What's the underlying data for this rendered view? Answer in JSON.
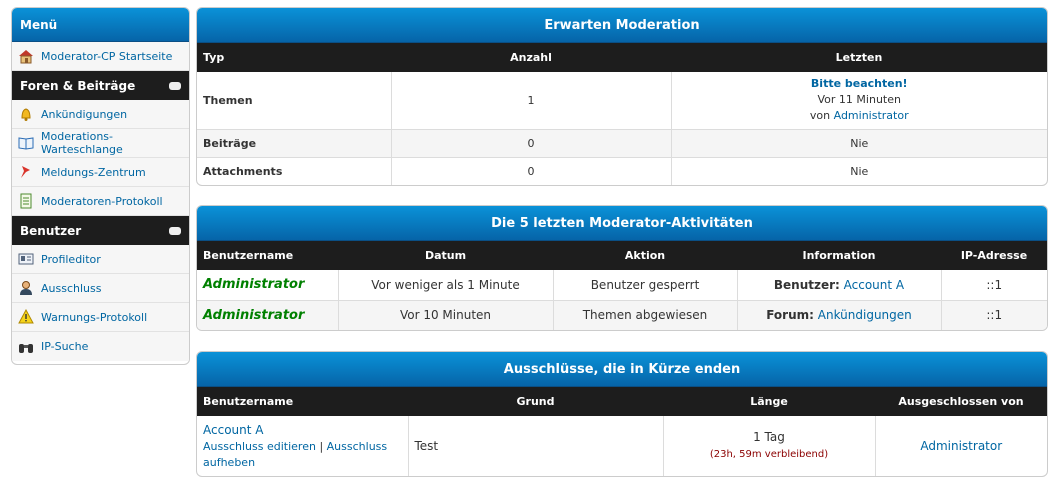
{
  "sidebar": {
    "title": "Menü",
    "items_top": [
      {
        "label": "Moderator-CP Startseite",
        "icon": "house-icon"
      }
    ],
    "section1": "Foren & Beiträge",
    "items1": [
      {
        "label": "Ankündigungen",
        "icon": "bell-icon"
      },
      {
        "label": "Moderations-Warteschlange",
        "icon": "book-icon"
      },
      {
        "label": "Meldungs-Zentrum",
        "icon": "pin-icon"
      },
      {
        "label": "Moderatoren-Protokoll",
        "icon": "notepad-icon"
      }
    ],
    "section2": "Benutzer",
    "items2": [
      {
        "label": "Profileditor",
        "icon": "id-card-icon"
      },
      {
        "label": "Ausschluss",
        "icon": "user-icon"
      },
      {
        "label": "Warnungs-Protokoll",
        "icon": "warning-icon"
      },
      {
        "label": "IP-Suche",
        "icon": "binoculars-icon"
      }
    ]
  },
  "moderation": {
    "title": "Erwarten Moderation",
    "headers": [
      "Typ",
      "Anzahl",
      "Letzten"
    ],
    "rows": [
      {
        "type": "Themen",
        "count": "1",
        "last_title": "Bitte beachten!",
        "last_time": "Vor 11 Minuten",
        "last_by_prefix": "von",
        "last_by": "Administrator"
      },
      {
        "type": "Beiträge",
        "count": "0",
        "last": "Nie"
      },
      {
        "type": "Attachments",
        "count": "0",
        "last": "Nie"
      }
    ]
  },
  "activity": {
    "title": "Die 5 letzten Moderator-Aktivitäten",
    "headers": [
      "Benutzername",
      "Datum",
      "Aktion",
      "Information",
      "IP-Adresse"
    ],
    "rows": [
      {
        "user": "Administrator",
        "date": "Vor weniger als 1 Minute",
        "action": "Benutzer gesperrt",
        "info_label": "Benutzer:",
        "info_value": "Account A",
        "ip": "::1"
      },
      {
        "user": "Administrator",
        "date": "Vor 10 Minuten",
        "action": "Themen abgewiesen",
        "info_label": "Forum:",
        "info_value": "Ankündigungen",
        "ip": "::1"
      }
    ]
  },
  "bans": {
    "title": "Ausschlüsse, die in Kürze enden",
    "headers": [
      "Benutzername",
      "Grund",
      "Länge",
      "Ausgeschlossen von"
    ],
    "rows": [
      {
        "user": "Account A",
        "edit": "Ausschluss editieren",
        "sep": "|",
        "lift": "Ausschluss aufheben",
        "reason": "Test",
        "length": "1 Tag",
        "remaining": "(23h, 59m verbleibend)",
        "by": "Administrator"
      }
    ]
  },
  "colors": {
    "accent": "#0664a8",
    "header_dark": "#1d1d1d",
    "admin_green": "#008000"
  }
}
